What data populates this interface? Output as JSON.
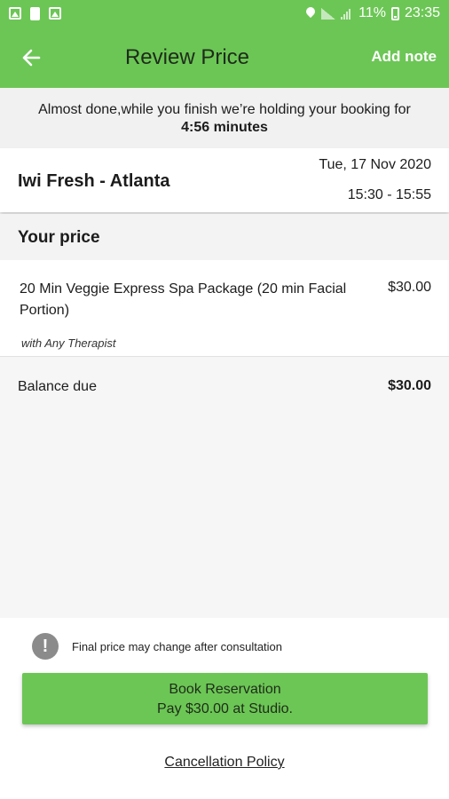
{
  "status_bar": {
    "battery_pct": "11%",
    "time": "23:35",
    "icons_left": [
      "image-icon",
      "document-icon",
      "gallery-icon"
    ],
    "icons_right": [
      "location-icon",
      "wifi-icon",
      "signal-icon",
      "battery-icon"
    ]
  },
  "header": {
    "title": "Review Price",
    "action": "Add note",
    "back_icon": "arrow-left-icon",
    "color": "#6cc655"
  },
  "hold_notice": {
    "message": "Almost done,while you finish we’re holding your booking for",
    "time": "4:56 minutes"
  },
  "venue": {
    "name": "Iwi Fresh - Atlanta",
    "date": "Tue, 17 Nov 2020",
    "time_range": "15:30 - 15:55"
  },
  "price_section": {
    "title": "Your price",
    "items": [
      {
        "description": "20 Min Veggie Express Spa Package (20 min Facial Portion)",
        "price": "$30.00",
        "therapist": "with Any Therapist"
      }
    ],
    "balance_label": "Balance due",
    "balance_amount": "$30.00"
  },
  "footer": {
    "notice": "Final price may change after consultation",
    "notice_icon": "info-icon",
    "book_button": {
      "line1": "Book Reservation",
      "line2": "Pay $30.00 at Studio."
    },
    "policy_link": "Cancellation Policy"
  }
}
